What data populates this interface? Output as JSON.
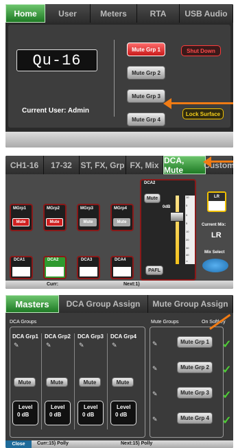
{
  "panel1": {
    "tabs": [
      "Home",
      "User",
      "Meters",
      "RTA",
      "USB Audio"
    ],
    "logo": "Qu-16",
    "current_user": "Current User: Admin",
    "mute_groups": [
      "Mute Grp 1",
      "Mute Grp 2",
      "Mute Grp 3",
      "Mute Grp 4"
    ],
    "shut_down": "Shut Down",
    "lock_surface": "Lock Surface"
  },
  "panel2": {
    "tabs": [
      "CH1-16",
      "17-32",
      "ST, FX, Grp",
      "FX, Mix",
      "DCA, Mute",
      "Custom"
    ],
    "mgrps": [
      {
        "label": "MGrp1",
        "mute": "Mute",
        "active": true
      },
      {
        "label": "MGrp2",
        "mute": "Mute",
        "active": true
      },
      {
        "label": "MGrp3",
        "mute": "Mute",
        "active": false
      },
      {
        "label": "MGrp4",
        "mute": "Mute",
        "active": false
      }
    ],
    "dcas": [
      "DCA1",
      "DCA2",
      "DCA3",
      "DCA4"
    ],
    "fader": {
      "name": "DCA2",
      "mute": "Mute",
      "level": "0dB",
      "pafl": "PAFL",
      "scale": [
        "10",
        "5",
        "0",
        "5",
        "10",
        "20",
        "30",
        "40",
        "∞"
      ]
    },
    "lr_label": "LR",
    "current_mix_label": "Current Mix:",
    "current_mix": "LR",
    "mix_select": "Mix Select",
    "status_curr": "Curr:",
    "status_next": "Next:1)"
  },
  "panel3": {
    "tabs": [
      "Masters",
      "DCA Group Assign",
      "Mute Group Assign"
    ],
    "dca_groups_label": "DCA Groups",
    "mute_groups_label": "Mute Groups",
    "on_softkey": "On Softkey",
    "dca_cards": [
      {
        "name": "DCA Grp1",
        "mute": "Mute",
        "level_label": "Level",
        "level": "0 dB"
      },
      {
        "name": "DCA Grp2",
        "mute": "Mute",
        "level_label": "Level",
        "level": "0 dB"
      },
      {
        "name": "DCA Grp3",
        "mute": "Mute",
        "level_label": "Level",
        "level": "0 dB"
      },
      {
        "name": "DCA Grp4",
        "mute": "Mute",
        "level_label": "Level",
        "level": "0 dB"
      }
    ],
    "mute_buttons": [
      "Mute Grp 1",
      "Mute Grp 2",
      "Mute Grp 3",
      "Mute Grp 4"
    ],
    "close": "Close",
    "status_curr": "Curr:15) Polly",
    "status_next": "Next:15) Polly"
  },
  "colors": {
    "accent_green": "#1f8a2a",
    "mute_red": "#d01f1f",
    "arrow": "#f07b14",
    "lock_yellow": "#f2c200",
    "select_blue": "#2a86c8"
  }
}
